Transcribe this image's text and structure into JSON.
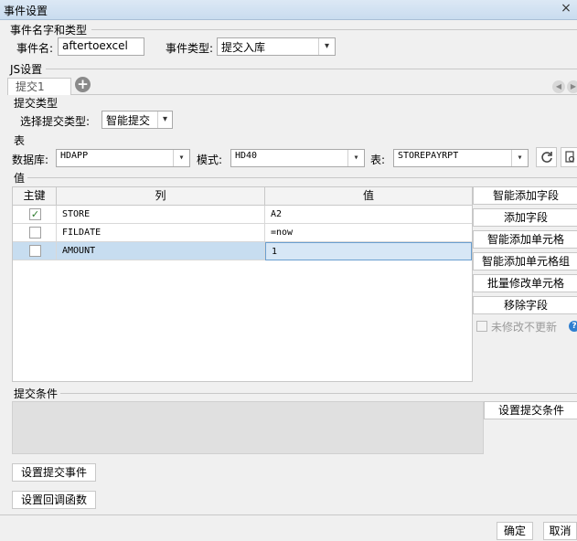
{
  "window": {
    "title": "事件设置",
    "close_label": "×"
  },
  "name_type": {
    "group_title": "事件名字和类型",
    "name_label": "事件名:",
    "name_value": "aftertoexcel",
    "type_label": "事件类型:",
    "type_value": "提交入库"
  },
  "js": {
    "group_title": "JS设置",
    "tab_label": "提交1",
    "add_tab_icon": "plus-icon",
    "submit_type_title": "提交类型",
    "submit_type_label": "选择提交类型:",
    "submit_type_value": "智能提交"
  },
  "table_section": {
    "title": "表",
    "db_label": "数据库:",
    "db_value": "HDAPP",
    "schema_label": "模式:",
    "schema_value": "HD40",
    "table_label": "表:",
    "table_value": "STOREPAYRPT",
    "refresh_icon": "refresh-icon",
    "preview_icon": "preview-icon"
  },
  "values": {
    "title": "值",
    "headers": {
      "key": "主键",
      "column": "列",
      "value": "值"
    },
    "rows": [
      {
        "key": true,
        "column": "STORE",
        "value": "A2"
      },
      {
        "key": false,
        "column": "FILDATE",
        "value": "=now"
      },
      {
        "key": false,
        "column": "AMOUNT",
        "value": "1"
      }
    ],
    "buttons": {
      "smart_add_field": "智能添加字段",
      "add_field": "添加字段",
      "smart_add_cell": "智能添加单元格",
      "smart_add_cell_group": "智能添加单元格组",
      "batch_edit_cell": "批量修改单元格",
      "remove_field": "移除字段"
    },
    "no_update_label": "未修改不更新",
    "help_glyph": "?"
  },
  "condition": {
    "title": "提交条件",
    "set_button": "设置提交条件"
  },
  "bottom_buttons": {
    "set_submit_event": "设置提交事件",
    "set_callback": "设置回调函数"
  },
  "footer": {
    "ok": "确定",
    "cancel": "取消"
  }
}
